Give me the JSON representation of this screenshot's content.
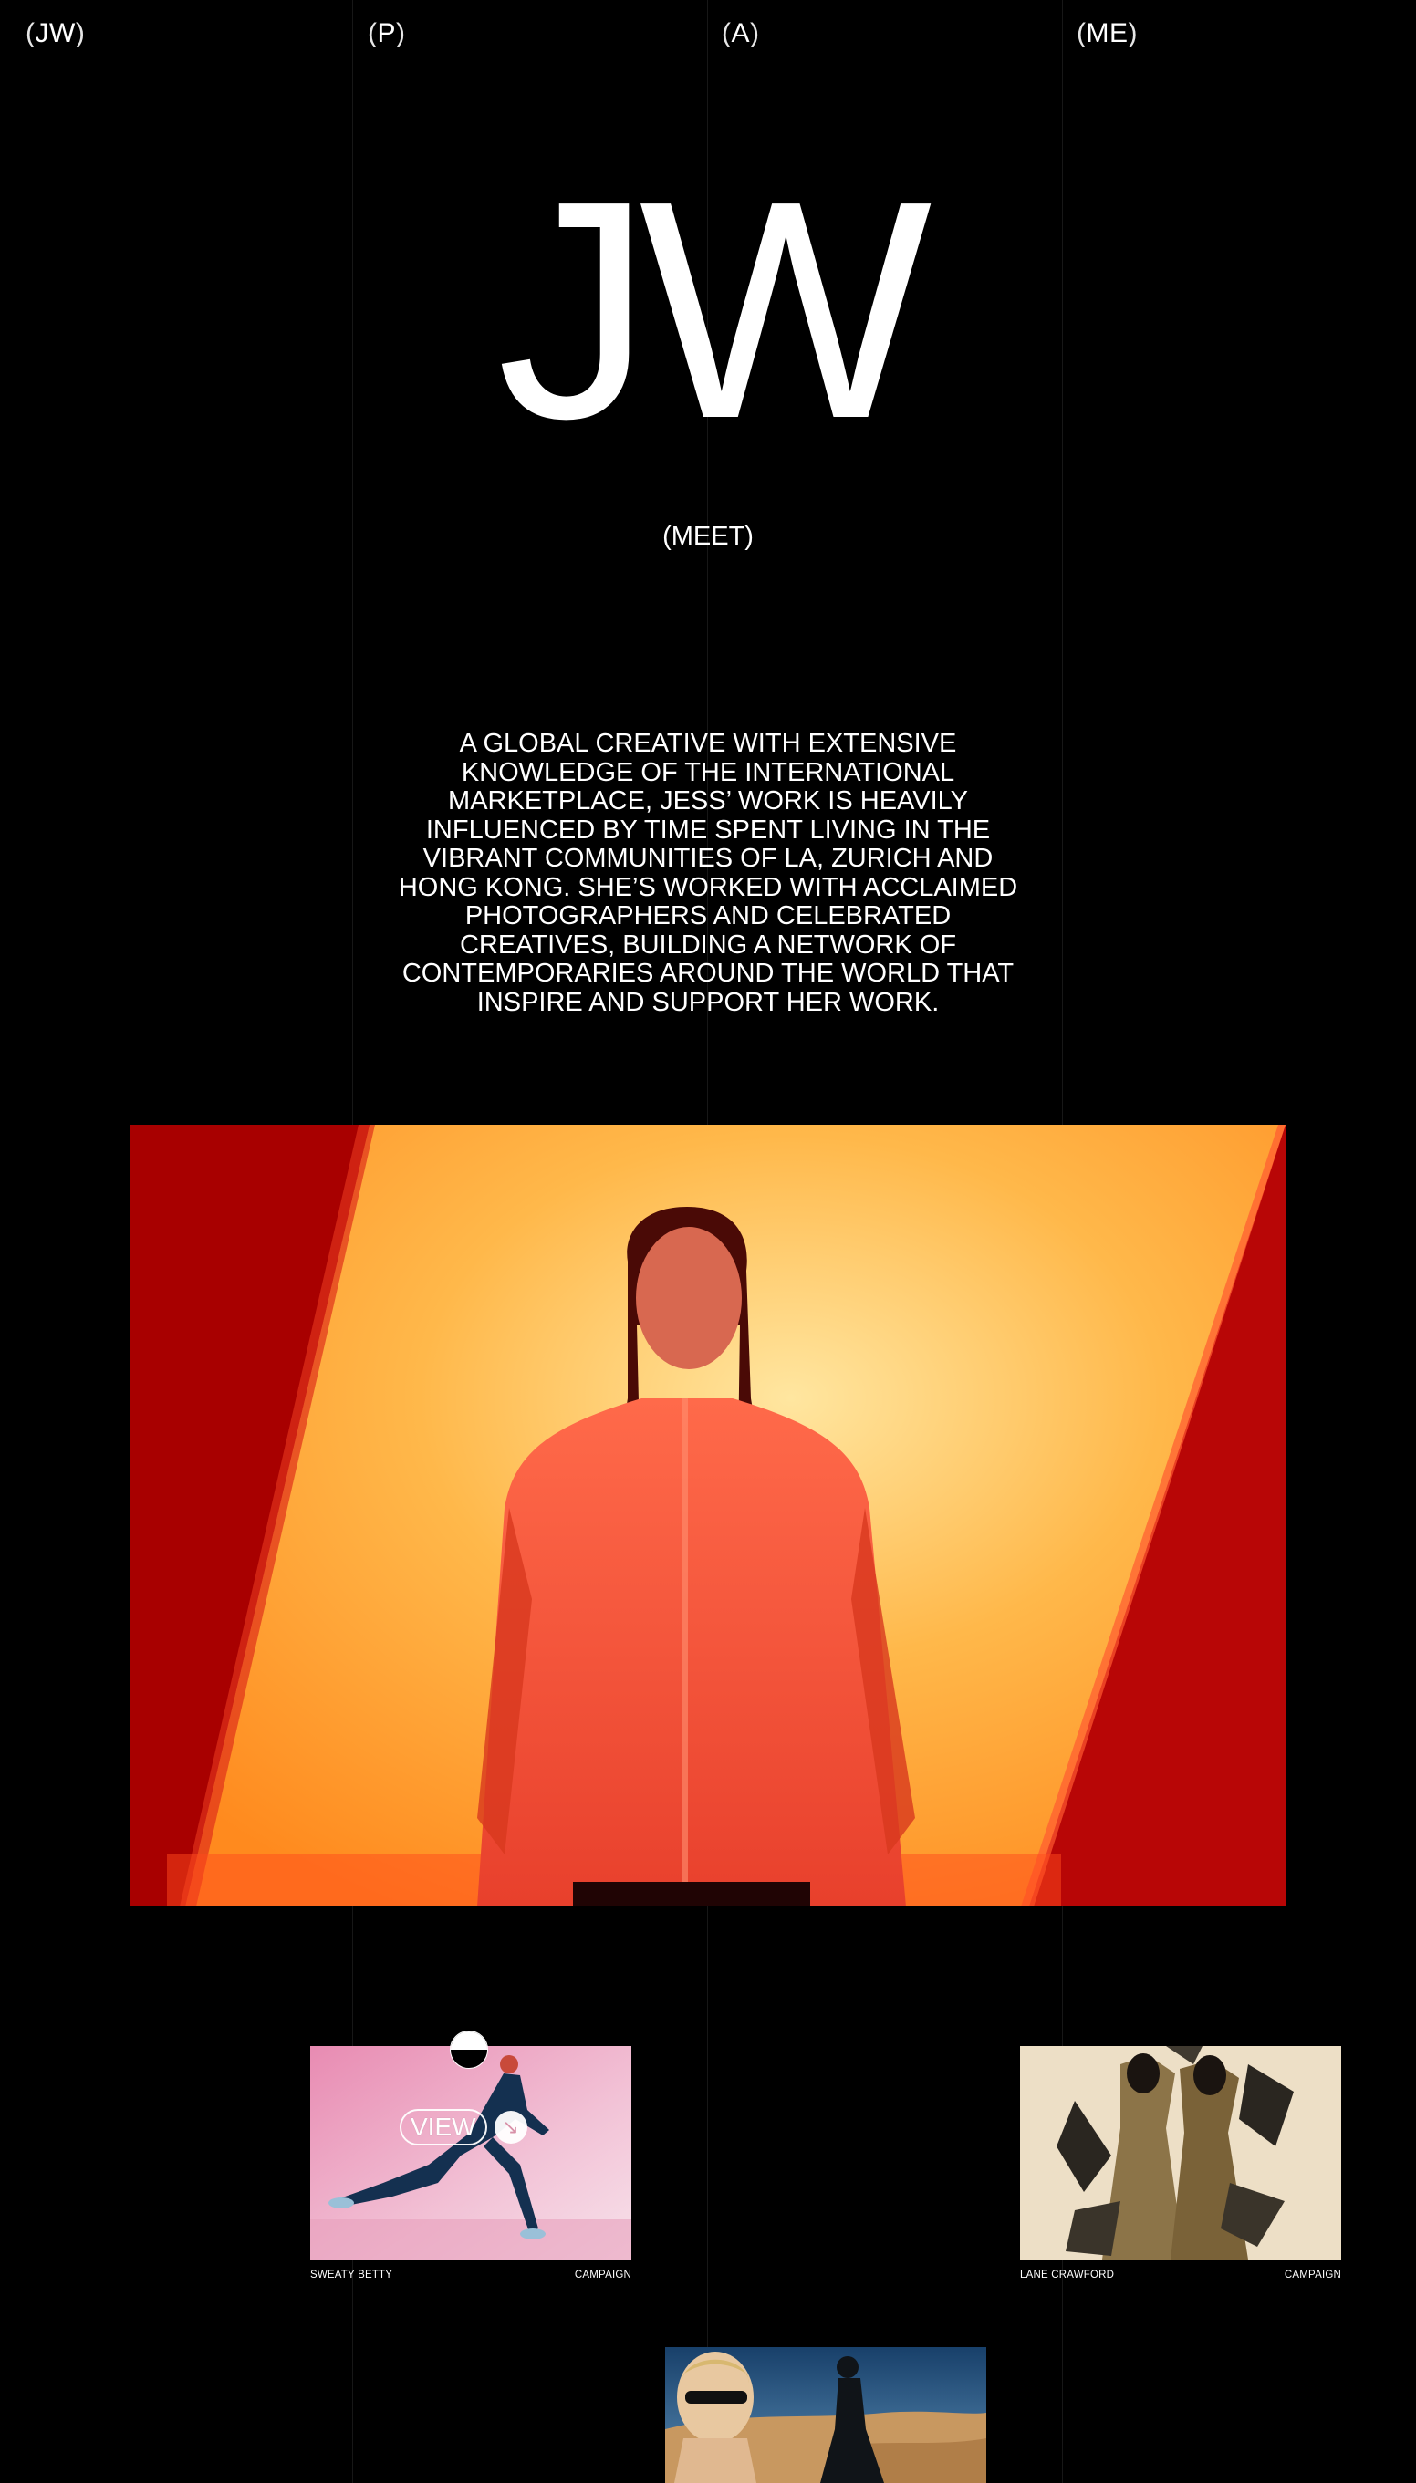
{
  "nav": {
    "items": [
      {
        "label": "JW",
        "open": "(",
        "close": ")"
      },
      {
        "label": "P",
        "open": "(",
        "close": ")"
      },
      {
        "label": "A",
        "open": "(",
        "close": ")"
      },
      {
        "label": "ME",
        "open": "(",
        "close": ")"
      }
    ]
  },
  "hero": {
    "logo": "JW",
    "meet_label": "(MEET)"
  },
  "intro": {
    "text": "A GLOBAL CREATIVE WITH EXTENSIVE KNOWLEDGE OF THE INTERNATIONAL MARKETPLACE, JESS’ WORK IS HEAVILY INFLUENCED BY TIME SPENT LIVING IN THE VIBRANT COMMUNITIES OF LA, ZURICH AND HONG KONG. SHE’S WORKED WITH ACCLAIMED PHOTOGRAPHERS AND CELEBRATED CREATIVES, BUILDING A NETWORK OF CONTEMPORARIES AROUND THE WORLD THAT INSPIRE AND SUPPORT HER WORK."
  },
  "projects": [
    {
      "client": "SWEATY BETTY",
      "category": "CAMPAIGN",
      "hover_label": "VIEW",
      "hover_icon": "arrow-down-right-icon"
    },
    {
      "client": "LANE CRAWFORD",
      "category": "CAMPAIGN"
    },
    {
      "client": "",
      "category": ""
    }
  ],
  "colors": {
    "background": "#000000",
    "text": "#ffffff",
    "hero_red": "#c40000",
    "hero_orange": "#ffb040"
  }
}
